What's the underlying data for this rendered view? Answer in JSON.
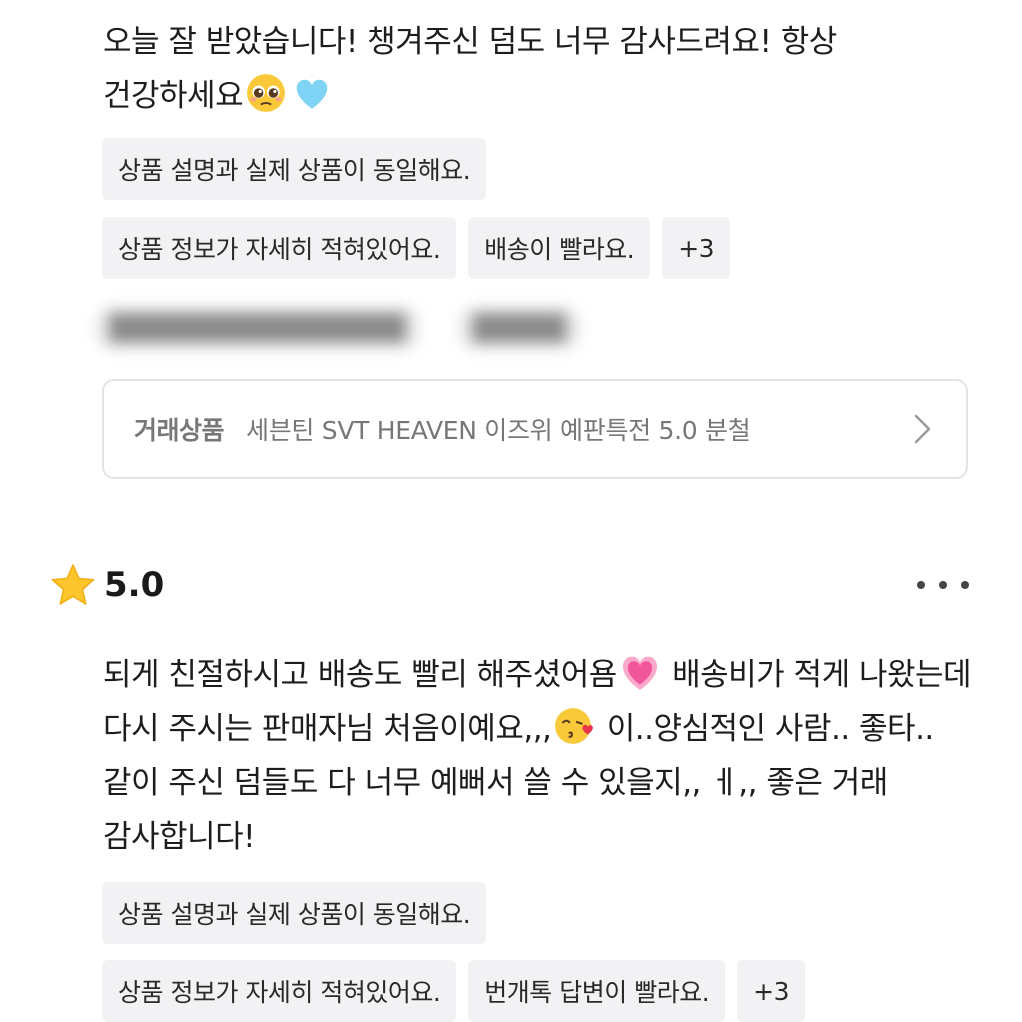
{
  "reviews": [
    {
      "text_1": "오늘 잘 받았습니다! 챙겨주신 덤도 너무 감사드려요! 항상 건강하세요",
      "emojis": [
        "pleading-face-emoji",
        "light-blue-heart-emoji"
      ],
      "tags": [
        "상품 설명과 실제 상품이 동일해요.",
        "상품 정보가 자세히 적혀있어요.",
        "배송이 빨라요.",
        "+3"
      ]
    },
    {
      "rating": "5.0",
      "text_1": "되게 친절하시고 배송도 빨리 해주셨어욤",
      "text_2": " 배송비가 적게 나왔는데 다시 주시는 판매자님 처음이예요,,,",
      "text_3": " 이..양심적인 사람.. 좋타.. 같이 주신 덤들도 다 너무 예뻐서 쓸 수 있을지,, ㅔ,, 좋은  거래 감사합니다!",
      "emojis": [
        "growing-heart-emoji",
        "face-blowing-kiss-emoji"
      ],
      "tags": [
        "상품 설명과 실제 상품이 동일해요.",
        "상품 정보가 자세히 적혀있어요.",
        "번개톡 답변이 빨라요.",
        "+3"
      ]
    }
  ],
  "trade": {
    "label": "거래상품",
    "title": "세븐틴 SVT HEAVEN 이즈위 예판특전 5.0 분철"
  },
  "blurred": {
    "a": "████████████████",
    "b": "█████"
  },
  "icons": {
    "star": "star-icon",
    "chevron": "chevron-right-icon",
    "more": "more-icon"
  },
  "colors": {
    "tag_bg": "#f2f2f4",
    "star": "#fbc52b",
    "muted_text": "#777777"
  }
}
